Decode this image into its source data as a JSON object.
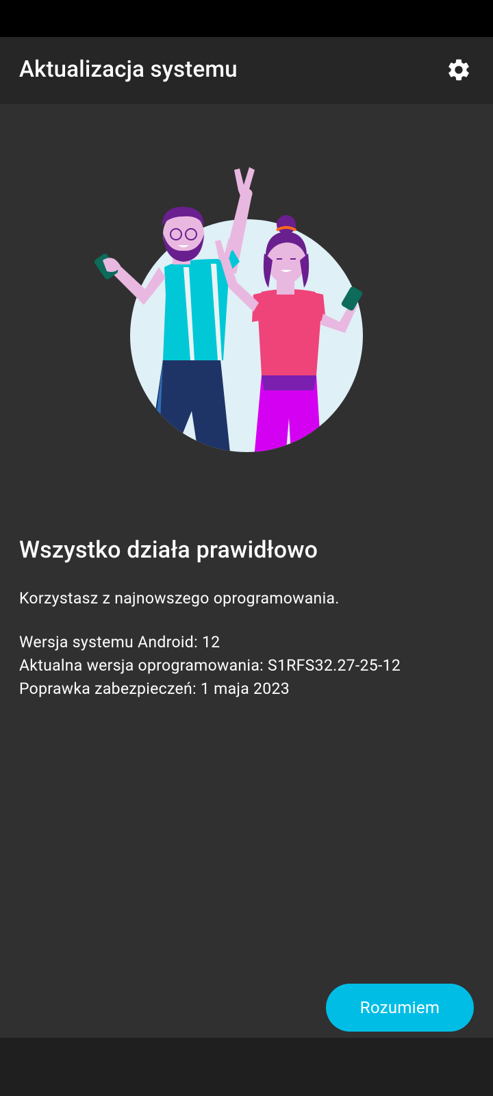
{
  "app_bar": {
    "title": "Aktualizacja systemu",
    "settings_icon": "gear-icon"
  },
  "illustration": {
    "name": "two-people-celebrating-illustration",
    "colors": {
      "circle": "#dff0f6",
      "man_shirt": "#00c8d7",
      "man_pants": "#1f3466",
      "woman_shirt": "#ef4479",
      "woman_pants": "#d400f2",
      "hair": "#6a1f8f",
      "skin": "#e9b8e0"
    }
  },
  "status": {
    "headline": "Wszystko działa prawidłowo",
    "subtitle": "Korzystasz z najnowszego oprogramowania."
  },
  "info": {
    "android_version": "Wersja systemu Android: 12",
    "software_version": "Aktualna wersja oprogramowania: S1RFS32.27-25-12",
    "security_patch": "Poprawka zabezpieczeń: 1 maja 2023"
  },
  "actions": {
    "ok_label": "Rozumiem",
    "ok_color": "#00bde6"
  },
  "colors": {
    "background": "#303030",
    "app_bar": "#262626",
    "status_bar": "#000000",
    "nav_bar": "#1f1f1f"
  }
}
